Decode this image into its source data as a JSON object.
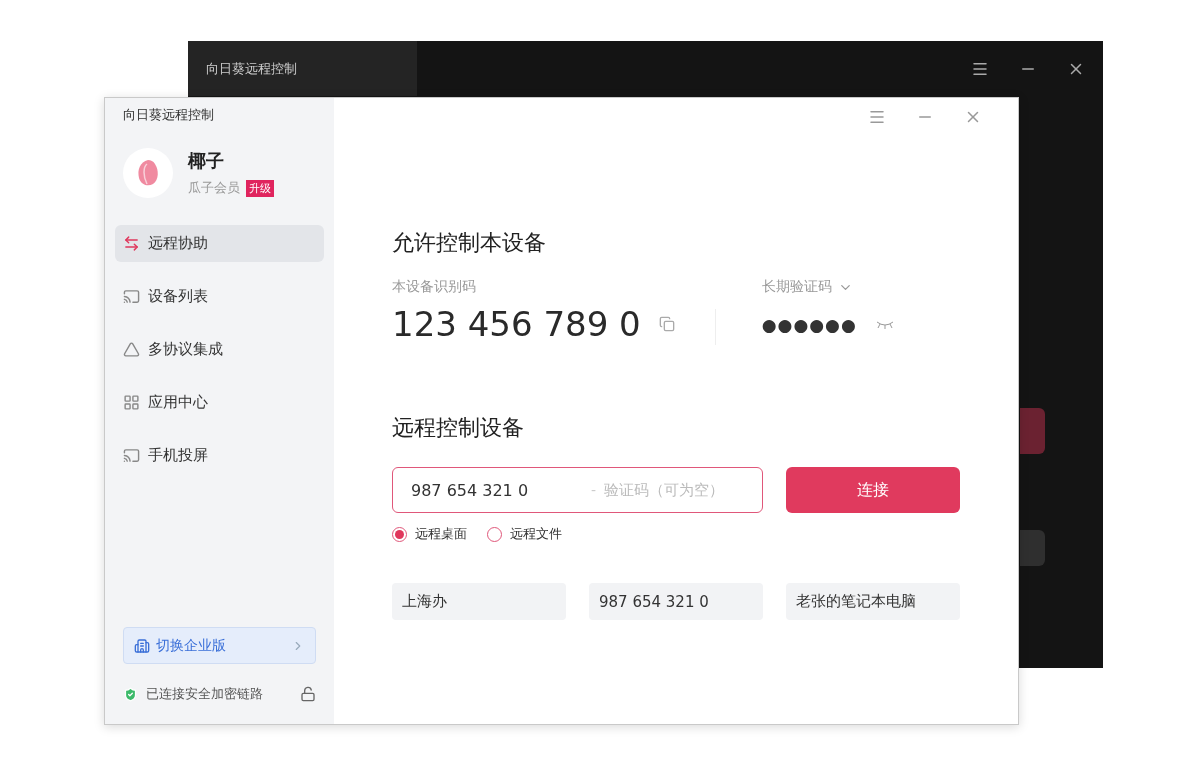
{
  "back_window": {
    "title": "向日葵远程控制"
  },
  "window": {
    "title": "向日葵远程控制",
    "user": {
      "name": "椰子",
      "membership": "瓜子会员",
      "badge": "升级"
    },
    "sidebar": {
      "items": [
        {
          "label": "远程协助",
          "selected": true
        },
        {
          "label": "设备列表",
          "selected": false
        },
        {
          "label": "多协议集成",
          "selected": false
        },
        {
          "label": "应用中心",
          "selected": false
        },
        {
          "label": "手机投屏",
          "selected": false
        }
      ],
      "enterprise_button": "切换企业版",
      "status": "已连接安全加密链路"
    },
    "allow_section": {
      "title": "允许控制本设备",
      "device_id_label": "本设备识别码",
      "device_id": "123 456 789 0",
      "password_label": "长期验证码",
      "password": "●●●●●●"
    },
    "remote_section": {
      "title": "远程控制设备",
      "device_id_value": "987 654 321 0",
      "separator": "-",
      "code_placeholder": "验证码（可为空）",
      "connect_button": "连接",
      "modes": [
        {
          "label": "远程桌面",
          "selected": true
        },
        {
          "label": "远程文件",
          "selected": false
        }
      ],
      "recent": [
        "上海办",
        "987 654 321 0",
        "老张的笔记本电脑"
      ]
    }
  }
}
